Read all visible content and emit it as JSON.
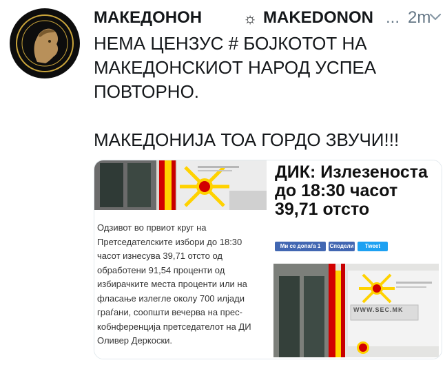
{
  "tweet": {
    "display_name": "МАКЕДОНОН",
    "separator_icon": "sun-icon",
    "handle": "MAKEDONON",
    "ellipsis": "...",
    "time": "2m",
    "lines": [
      "НЕМА ЦЕНЗУС # БОЈКОТОТ НА",
      "МАКЕДОНСКИОТ НАРОД УСПЕА",
      "ПОВТОРНО.",
      "",
      "МАКЕДОНИЈА ТОА ГОРДО ЗВУЧИ!!!"
    ]
  },
  "card": {
    "left_body": [
      "Одзивот во првиот круг на",
      "Претседателските избори до 18:30",
      "часот изнесува 39,71 отсто од",
      "обработени 91,54 проценти од",
      "избирачките места проценти или на",
      "фласање излегле околу 700 илјади",
      "граѓани, соопшти вечерва на прес-",
      "кобнференција претседателот на ДИ",
      "Оливер Деркоски."
    ],
    "right_headline": [
      "ДИК: Излезеноста",
      "до 18:30 часот",
      "39,71 отсто"
    ],
    "share_buttons": [
      "Ми се допаѓа 1",
      "Сподели",
      "Tweet"
    ],
    "sign_text": "WWW.SEC.MK"
  },
  "colors": {
    "flag_red": "#d20000",
    "flag_yellow": "#ffe600",
    "fb_blue": "#4267b2",
    "tw_blue": "#1da1f2",
    "muted": "#657786"
  }
}
